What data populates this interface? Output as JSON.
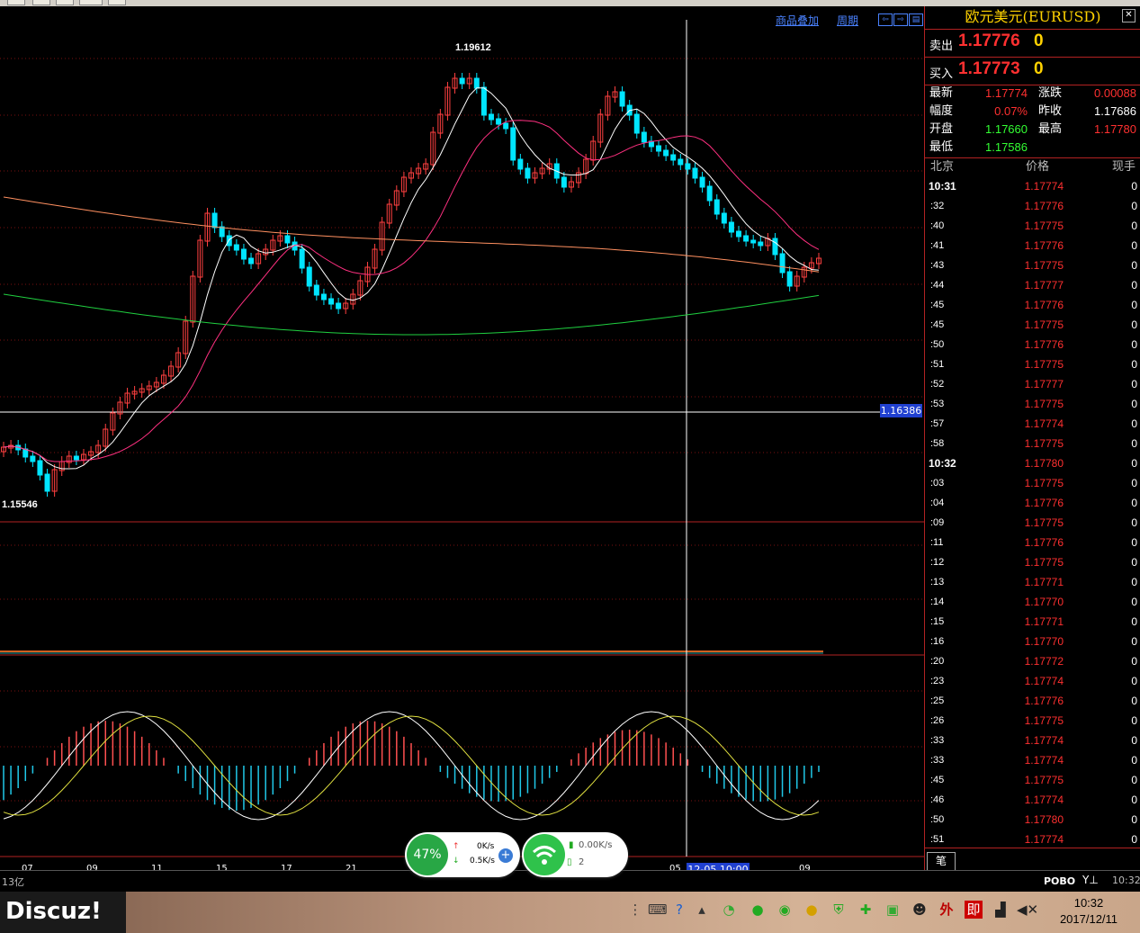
{
  "toolbar": {
    "overlay_label": "商品叠加",
    "period_label": "周期"
  },
  "chart": {
    "high_label": "1.19612",
    "low_label": "1.15546",
    "price_cursor": "1.16386",
    "x_labels": [
      "07",
      "09",
      "11",
      "15",
      "17",
      "21",
      "05",
      "09"
    ],
    "cursor_time": "12-05 10:00"
  },
  "panel": {
    "title": "欧元美元(EURUSD)",
    "sell_label": "卖出",
    "sell_price": "1.17776",
    "sell_vol": "0",
    "buy_label": "买入",
    "buy_price": "1.17773",
    "buy_vol": "0",
    "stats": [
      {
        "l1": "最新",
        "v1": "1.17774",
        "c1": "#ff3030",
        "l2": "涨跌",
        "v2": "0.00088",
        "c2": "#ff3030"
      },
      {
        "l1": "幅度",
        "v1": "0.07%",
        "c1": "#ff3030",
        "l2": "昨收",
        "v2": "1.17686",
        "c2": "#ffffff"
      },
      {
        "l1": "开盘",
        "v1": "1.17660",
        "c1": "#33ff33",
        "l2": "最高",
        "v2": "1.17780",
        "c2": "#ff3030"
      },
      {
        "l1": "最低",
        "v1": "1.17586",
        "c1": "#33ff33",
        "l2": "",
        "v2": "",
        "c2": "#ffffff"
      }
    ],
    "head_time": "北京",
    "head_price": "价格",
    "head_vol": "现手",
    "ticks": [
      {
        "t": "10:31",
        "p": "1.17774",
        "v": "0"
      },
      {
        "t": ":32",
        "p": "1.17776",
        "v": "0"
      },
      {
        "t": ":40",
        "p": "1.17775",
        "v": "0"
      },
      {
        "t": ":41",
        "p": "1.17776",
        "v": "0"
      },
      {
        "t": ":43",
        "p": "1.17775",
        "v": "0"
      },
      {
        "t": ":44",
        "p": "1.17777",
        "v": "0"
      },
      {
        "t": ":45",
        "p": "1.17776",
        "v": "0"
      },
      {
        "t": ":45",
        "p": "1.17775",
        "v": "0"
      },
      {
        "t": ":50",
        "p": "1.17776",
        "v": "0"
      },
      {
        "t": ":51",
        "p": "1.17775",
        "v": "0"
      },
      {
        "t": ":52",
        "p": "1.17777",
        "v": "0"
      },
      {
        "t": ":53",
        "p": "1.17775",
        "v": "0"
      },
      {
        "t": ":57",
        "p": "1.17774",
        "v": "0"
      },
      {
        "t": ":58",
        "p": "1.17775",
        "v": "0"
      },
      {
        "t": "10:32",
        "p": "1.17780",
        "v": "0"
      },
      {
        "t": ":03",
        "p": "1.17775",
        "v": "0"
      },
      {
        "t": ":04",
        "p": "1.17776",
        "v": "0"
      },
      {
        "t": ":09",
        "p": "1.17775",
        "v": "0"
      },
      {
        "t": ":11",
        "p": "1.17776",
        "v": "0"
      },
      {
        "t": ":12",
        "p": "1.17775",
        "v": "0"
      },
      {
        "t": ":13",
        "p": "1.17771",
        "v": "0"
      },
      {
        "t": ":14",
        "p": "1.17770",
        "v": "0"
      },
      {
        "t": ":15",
        "p": "1.17771",
        "v": "0"
      },
      {
        "t": ":16",
        "p": "1.17770",
        "v": "0"
      },
      {
        "t": ":20",
        "p": "1.17772",
        "v": "0"
      },
      {
        "t": ":23",
        "p": "1.17774",
        "v": "0"
      },
      {
        "t": ":25",
        "p": "1.17776",
        "v": "0"
      },
      {
        "t": ":26",
        "p": "1.17775",
        "v": "0"
      },
      {
        "t": ":33",
        "p": "1.17774",
        "v": "0"
      },
      {
        "t": ":33",
        "p": "1.17774",
        "v": "0"
      },
      {
        "t": ":45",
        "p": "1.17775",
        "v": "0"
      },
      {
        "t": ":46",
        "p": "1.17774",
        "v": "0"
      },
      {
        "t": ":50",
        "p": "1.17780",
        "v": "0"
      },
      {
        "t": ":51",
        "p": "1.17774",
        "v": "0"
      }
    ],
    "footer_tab": "笔"
  },
  "status": {
    "left": "13亿",
    "brand": "POBO",
    "time": "10:32"
  },
  "net": {
    "pct": "47%",
    "up": "0K/s",
    "down": "0.5K/s"
  },
  "wifi": {
    "rate": "0.00K/s",
    "count": "2"
  },
  "taskbar": {
    "logo": "Discuz!",
    "time": "10:32",
    "date": "2017/12/11",
    "ime": "外",
    "ime2": "即"
  }
}
